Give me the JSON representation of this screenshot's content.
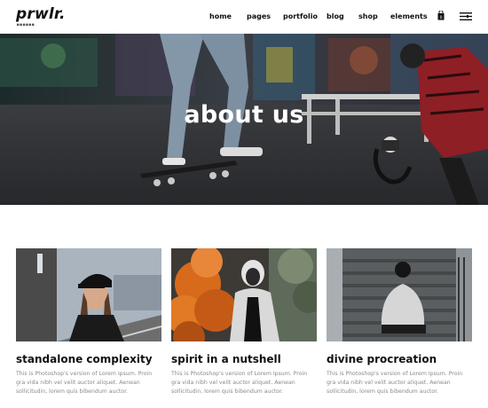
{
  "header": {
    "logo": "prwlr.",
    "logo_sub": "■■■■■■",
    "nav": [
      {
        "label": "home"
      },
      {
        "label": "pages"
      },
      {
        "label": "portfolio"
      },
      {
        "label": "blog"
      },
      {
        "label": "shop"
      },
      {
        "label": "elements"
      }
    ],
    "cart_icon": "shopping-bag-icon",
    "menu_icon": "hamburger-menu-icon"
  },
  "hero": {
    "title": "about us"
  },
  "cards": [
    {
      "title": "standalone complexity",
      "text": "This is Photoshop's version of Lorem Ipsum. Proin gra vida nibh vel velit auctor aliquet. Aenean sollicitudin, lorem quis bibendum auctor."
    },
    {
      "title": "spirit in a nutshell",
      "text": "This is Photoshop's version of Lorem Ipsum. Proin gra vida nibh vel velit auctor aliquet. Aenean sollicitudin, lorem quis bibendum auctor."
    },
    {
      "title": "divine procreation",
      "text": "This is Photoshop's version of Lorem Ipsum. Proin gra vida nibh vel velit auctor aliquet. Aenean sollicitudin, lorem quis bibendum auctor."
    }
  ]
}
